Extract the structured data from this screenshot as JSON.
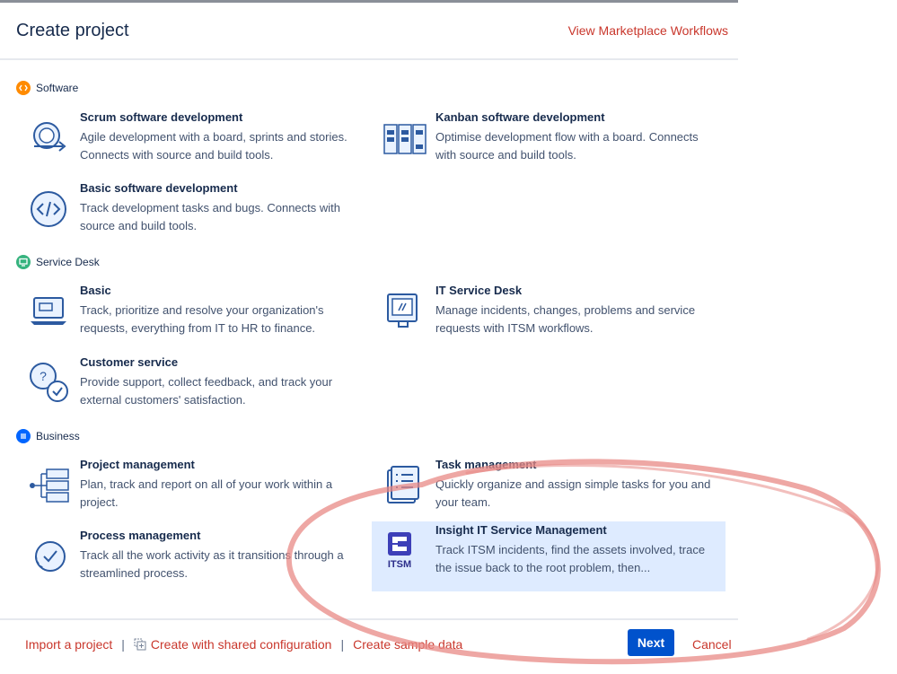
{
  "dialog": {
    "title": "Create project",
    "marketplace_link": "View Marketplace Workflows"
  },
  "sections": {
    "software": {
      "label": "Software",
      "color": "#ff8b00",
      "templates": [
        {
          "name": "Scrum software development",
          "desc": "Agile development with a board, sprints and stories. Connects with source and build tools."
        },
        {
          "name": "Kanban software development",
          "desc": "Optimise development flow with a board. Connects with source and build tools."
        },
        {
          "name": "Basic software development",
          "desc": "Track development tasks and bugs. Connects with source and build tools."
        }
      ]
    },
    "service_desk": {
      "label": "Service Desk",
      "color": "#36b37e",
      "templates": [
        {
          "name": "Basic",
          "desc": "Track, prioritize and resolve your organization's requests, everything from IT to HR to finance."
        },
        {
          "name": "IT Service Desk",
          "desc": "Manage incidents, changes, problems and service requests with ITSM workflows."
        },
        {
          "name": "Customer service",
          "desc": "Provide support, collect feedback, and track your external customers' satisfaction."
        }
      ]
    },
    "business": {
      "label": "Business",
      "color": "#0065ff",
      "templates": [
        {
          "name": "Project management",
          "desc": "Plan, track and report on all of your work within a project."
        },
        {
          "name": "Task management",
          "desc": "Quickly organize and assign simple tasks for you and your team."
        },
        {
          "name": "Process management",
          "desc": "Track all the work activity as it transitions through a streamlined process."
        },
        {
          "name": "Insight IT Service Management",
          "desc": "Track ITSM incidents, find the assets involved, trace the issue back to the root problem, then...",
          "icon_text": "ITSM"
        }
      ]
    }
  },
  "footer": {
    "import_link": "Import a project",
    "shared_config_link": "Create with shared configuration",
    "sample_data_link": "Create sample data",
    "separator": "|",
    "next_label": "Next",
    "cancel_label": "Cancel"
  },
  "colors": {
    "link": "#c9372c",
    "primary": "#0052cc",
    "selected_bg": "#deebff",
    "annotation": "#e88a86"
  },
  "icons": {
    "software": "code-icon",
    "service_desk": "monitor-icon",
    "business": "list-icon"
  }
}
